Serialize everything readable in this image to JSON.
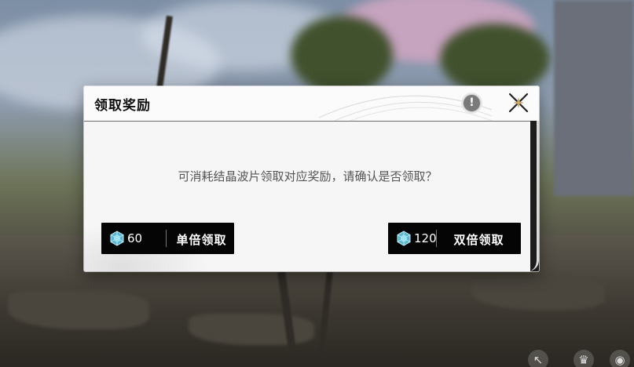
{
  "dialog": {
    "title": "领取奖励",
    "message": "可消耗结晶波片领取对应奖励，请确认是否领取？",
    "info_icon": "info-icon",
    "close_icon": "close-icon"
  },
  "buttons": [
    {
      "cost": "60",
      "label": "单倍领取",
      "icon": "crystal-icon"
    },
    {
      "cost": "120",
      "label": "双倍领取",
      "icon": "crystal-icon"
    }
  ],
  "colors": {
    "dialog_bg": "#f6f6f6",
    "button_bg": "#050505",
    "crystal": "#7fd3e6"
  }
}
